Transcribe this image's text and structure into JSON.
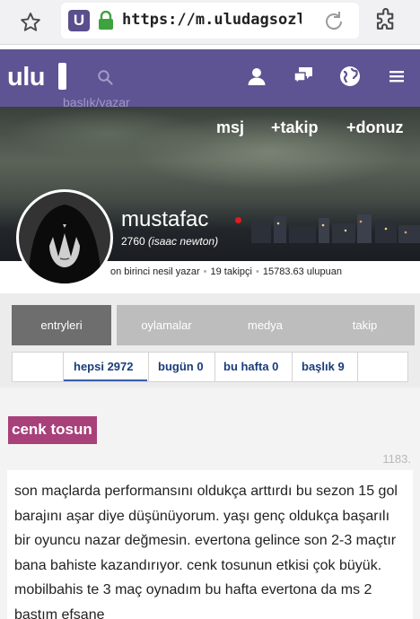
{
  "browser": {
    "url": "https://m.uludagsozl...",
    "site_badge": "U"
  },
  "header": {
    "logo": "ulu",
    "search_placeholder": "başlık/yazar"
  },
  "profile": {
    "actions": [
      "msj",
      "+takip",
      "+donuz"
    ],
    "username": "mustafac",
    "rank_points": "2760",
    "rank_title": "(isaac newton)",
    "stats": {
      "generation": "on birinci nesil yazar",
      "followers": "19 takipçi",
      "points": "15783.63 ulupuan"
    }
  },
  "tabs": [
    "entryleri",
    "oylamalar",
    "medya",
    "takip"
  ],
  "subtabs": [
    "hepsi 2972",
    "bugün 0",
    "bu hafta 0",
    "başlık 9"
  ],
  "entry": {
    "topic": "cenk tosun",
    "number": "1183.",
    "text": "son maçlarda performansını oldukça arttırdı bu sezon 15 gol barajını aşar diye düşünüyorum. yaşı genç oldukça başarılı bir oyuncu nazar değmesin. evertona gelince son 2-3 maçtır bana bahiste kazandırıyor. cenk tosunun etkisi çok büyük. mobilbahis te 3 maç oynadım bu hafta evertona da ms 2 bastım efsane"
  },
  "colors": {
    "header_bg": "#5e5393",
    "topic_bg": "#a8407a",
    "active_tab": "#6e6e6e",
    "inactive_tab": "#bdbdbd",
    "online_dot": "#e01b1b"
  }
}
